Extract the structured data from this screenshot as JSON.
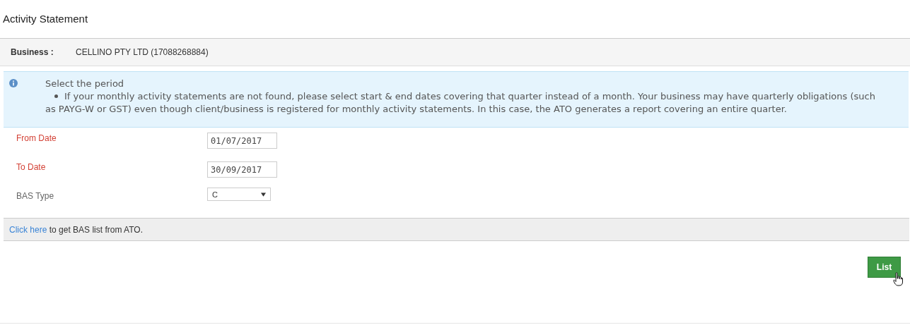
{
  "page_title": "Activity Statement",
  "business": {
    "label": "Business :",
    "value": "CELLINO PTY LTD (17088268884)"
  },
  "info": {
    "heading": "Select the period",
    "bullets": [
      "If your monthly activity statements are not found, please select start & end dates covering that quarter instead of a month. Your business may have quarterly obligations (such as PAYG-W or GST) even though client/business is registered for monthly activity statements. In this case, the ATO generates a report covering an entire quarter."
    ]
  },
  "fields": [
    {
      "kind": "date",
      "label": "From Date",
      "required": true,
      "value": "01/07/2017"
    },
    {
      "kind": "date",
      "label": "To Date",
      "required": true,
      "value": "30/09/2017"
    },
    {
      "kind": "select",
      "label": "BAS Type",
      "required": false,
      "value": "C"
    }
  ],
  "ato_bar": {
    "link": "Click here",
    "text": "to get BAS list from ATO."
  },
  "buttons": [
    {
      "label": "List"
    }
  ]
}
